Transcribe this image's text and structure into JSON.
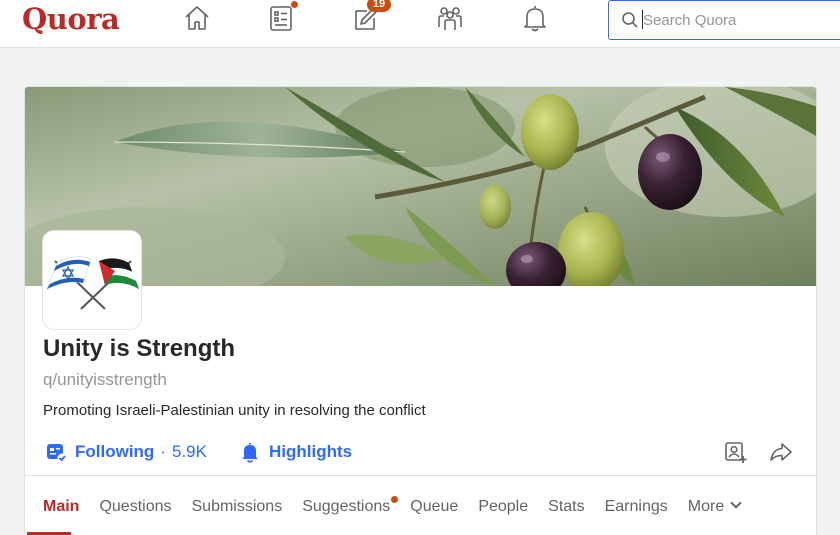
{
  "header": {
    "logo": "Quora",
    "nav": [
      {
        "name": "home-icon"
      },
      {
        "name": "following-feed-icon",
        "has_dot": true
      },
      {
        "name": "answer-icon",
        "badge": "19"
      },
      {
        "name": "spaces-icon"
      },
      {
        "name": "notifications-bell-icon"
      }
    ],
    "search": {
      "placeholder": "Search Quora",
      "value": ""
    }
  },
  "space": {
    "name": "Unity is Strength",
    "handle": "q/unityisstrength",
    "description": "Promoting Israeli-Palestinian unity in resolving the conflict",
    "avatar": "israel-palestine-crossed-flags",
    "cover": "olive-branch-photo",
    "following_label": "Following",
    "follower_count": "5.9K",
    "separator": "·",
    "highlights_label": "Highlights"
  },
  "tabs": [
    {
      "label": "Main",
      "active": true
    },
    {
      "label": "Questions"
    },
    {
      "label": "Submissions"
    },
    {
      "label": "Suggestions",
      "has_dot": true
    },
    {
      "label": "Queue"
    },
    {
      "label": "People"
    },
    {
      "label": "Stats"
    },
    {
      "label": "Earnings"
    },
    {
      "label": "More"
    }
  ],
  "colors": {
    "brand": "#b92b27",
    "accent": "#2e69ff",
    "notification": "#cb4b10"
  }
}
